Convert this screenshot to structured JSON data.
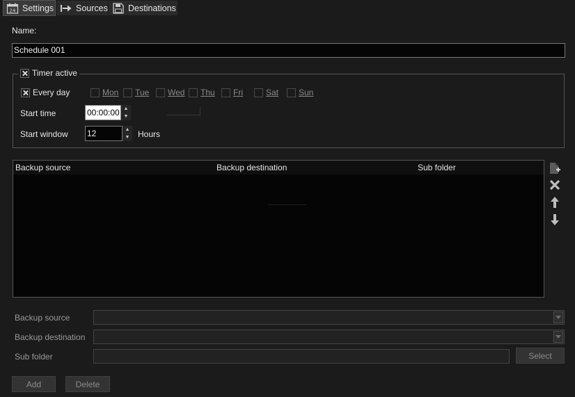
{
  "tabs": [
    {
      "label": "Settings",
      "icon": "calendar-icon",
      "active": true
    },
    {
      "label": "Sources",
      "icon": "arrow-right-icon",
      "active": false
    },
    {
      "label": "Destinations",
      "icon": "floppy-disk-icon",
      "active": false
    }
  ],
  "calendar_icon_text": "24",
  "name": {
    "label": "Name:",
    "value": "Schedule 001"
  },
  "timer": {
    "label": "Timer active",
    "checked": true,
    "every_day": {
      "label": "Every day",
      "checked": true
    },
    "days": [
      "Mon",
      "Tue",
      "Wed",
      "Thu",
      "Fri",
      "Sat",
      "Sun"
    ],
    "start_time": {
      "label": "Start time",
      "value": "00:00:00"
    },
    "start_window": {
      "label": "Start window",
      "value": "12",
      "unit": "Hours"
    }
  },
  "table": {
    "columns": [
      "Backup source",
      "Backup destination",
      "Sub folder"
    ],
    "rows": []
  },
  "side_tools": [
    "add-item-icon",
    "delete-icon",
    "move-up-icon",
    "move-down-icon"
  ],
  "form": {
    "backup_source": {
      "label": "Backup source",
      "value": ""
    },
    "backup_destination": {
      "label": "Backup destination",
      "value": ""
    },
    "sub_folder": {
      "label": "Sub folder",
      "value": ""
    },
    "select_label": "Select"
  },
  "actions": {
    "add_label": "Add",
    "delete_label": "Delete"
  },
  "colors": {
    "background": "#1b1b1b",
    "field_bg": "#050505",
    "text": "#e6e6e6",
    "disabled_text": "#8a8a8a"
  }
}
